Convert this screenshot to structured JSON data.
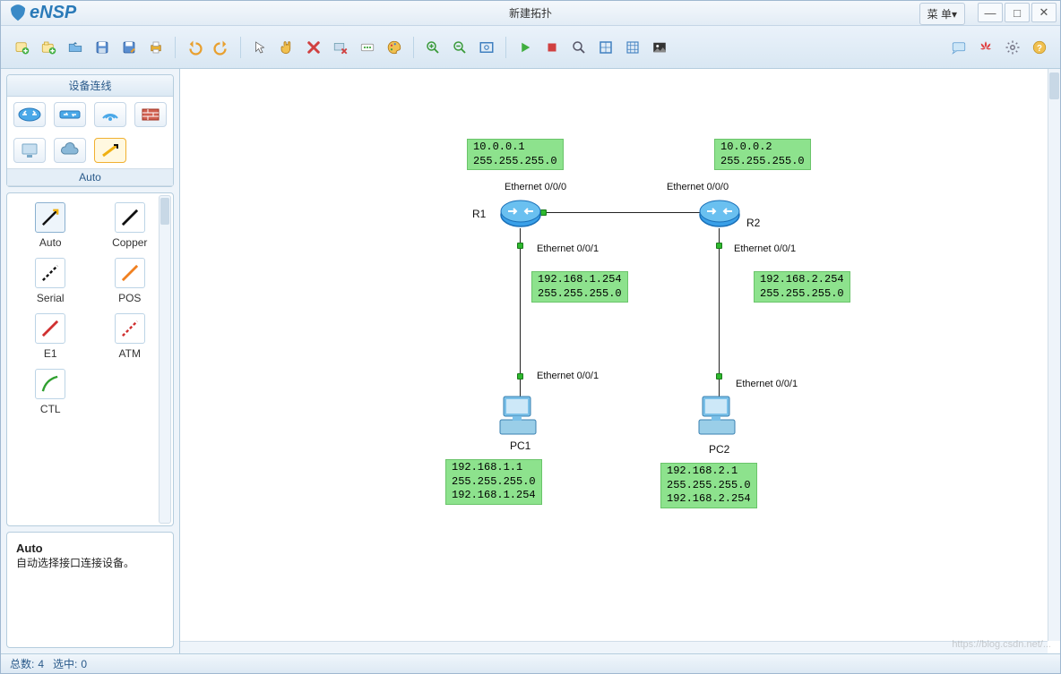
{
  "app": {
    "name": "eNSP",
    "title": "新建拓扑"
  },
  "menu_btn": "菜 单▾",
  "win": {
    "min": "—",
    "max": "□",
    "close": "✕"
  },
  "sidebar": {
    "panel_title": "设备连线",
    "categories": [
      "router",
      "switch",
      "wireless",
      "firewall"
    ],
    "categories2": [
      "terminal",
      "cloud",
      "link"
    ],
    "sub_title": "Auto",
    "items": [
      {
        "name": "Auto",
        "icon": "auto"
      },
      {
        "name": "Copper",
        "icon": "copper"
      },
      {
        "name": "Serial",
        "icon": "serial"
      },
      {
        "name": "POS",
        "icon": "pos"
      },
      {
        "name": "E1",
        "icon": "e1"
      },
      {
        "name": "ATM",
        "icon": "atm"
      },
      {
        "name": "CTL",
        "icon": "ctl"
      }
    ],
    "desc_title": "Auto",
    "desc_body": "自动选择接口连接设备。"
  },
  "topology": {
    "r1": {
      "name": "R1",
      "port_top": "Ethernet 0/0/0",
      "port_bottom": "Ethernet 0/0/1",
      "ip_top": "10.0.0.1\n255.255.255.0",
      "ip_bottom": "192.168.1.254\n255.255.255.0"
    },
    "r2": {
      "name": "R2",
      "port_top": "Ethernet 0/0/0",
      "port_bottom": "Ethernet 0/0/1",
      "ip_top": "10.0.0.2\n255.255.255.0",
      "ip_bottom": "192.168.2.254\n255.255.255.0"
    },
    "pc1": {
      "name": "PC1",
      "port": "Ethernet 0/0/1",
      "config": "192.168.1.1\n255.255.255.0\n192.168.1.254"
    },
    "pc2": {
      "name": "PC2",
      "port": "Ethernet 0/0/1",
      "config": "192.168.2.1\n255.255.255.0\n192.168.2.254"
    }
  },
  "status": {
    "total_label": "总数:",
    "total": "4",
    "sel_label": "选中:",
    "sel": "0"
  },
  "watermark": "https://blog.csdn.net/..."
}
